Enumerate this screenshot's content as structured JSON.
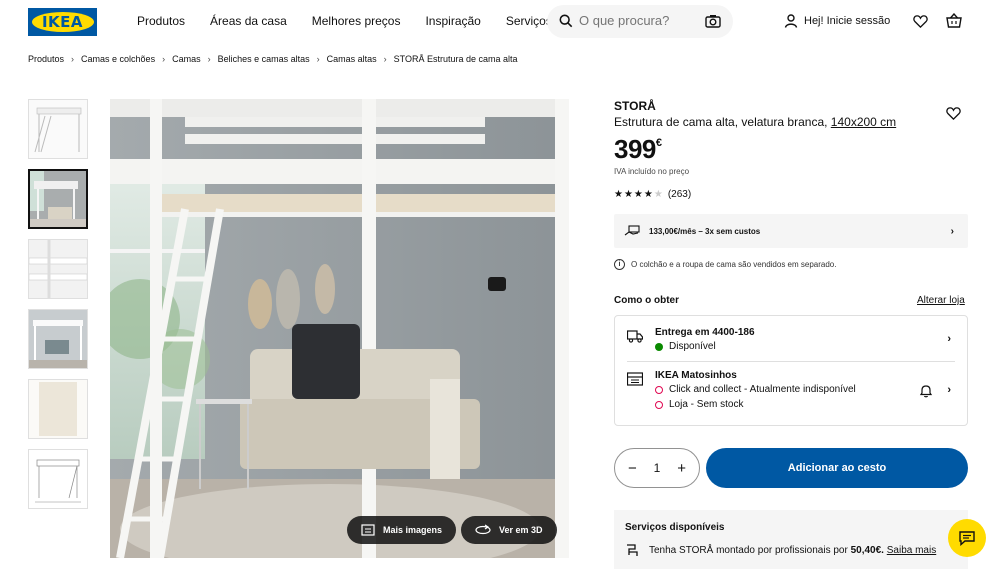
{
  "brand": {
    "logo_text": "IKEA",
    "primary": "#0058a3",
    "accent": "#ffdb00"
  },
  "nav": [
    "Produtos",
    "Áreas da casa",
    "Melhores preços",
    "Inspiração",
    "Serviços"
  ],
  "search": {
    "placeholder": "O que procura?"
  },
  "account": {
    "login_label": "Hej! Inicie sessão"
  },
  "breadcrumb": [
    "Produtos",
    "Camas e colchões",
    "Camas",
    "Beliches e camas altas",
    "Camas altas",
    "STORÅ Estrutura de cama alta"
  ],
  "gallery": {
    "thumbnail_count": 6,
    "active_index": 1,
    "more_images_label": "Mais imagens",
    "view_3d_label": "Ver em 3D"
  },
  "product": {
    "name": "STORÅ",
    "description": "Estrutura de cama alta, velatura branca,",
    "size": "140x200 cm",
    "price": "399",
    "currency": "€",
    "vat_note": "IVA incluído no preço",
    "rating_stars": 4,
    "rating_max": 5,
    "review_count": "(263)"
  },
  "financing": {
    "text": "133,00€/mês – 3x sem custos"
  },
  "notice": {
    "text": "O colchão e a roupa de cama são vendidos em separado."
  },
  "availability": {
    "title": "Como o obter",
    "change_store_label": "Alterar loja",
    "delivery": {
      "title": "Entrega em 4400-186",
      "status": "Disponível"
    },
    "store": {
      "title": "IKEA Matosinhos",
      "status1": "Click and collect - Atualmente indisponível",
      "status2": "Loja - Sem stock"
    }
  },
  "purchase": {
    "quantity": "1",
    "minus": "−",
    "plus": "+",
    "add_label": "Adicionar ao cesto"
  },
  "services": {
    "title": "Serviços disponíveis",
    "text_prefix": "Tenha STORÅ montado por profissionais por",
    "price": "50,40€.",
    "link": "Saiba mais"
  }
}
